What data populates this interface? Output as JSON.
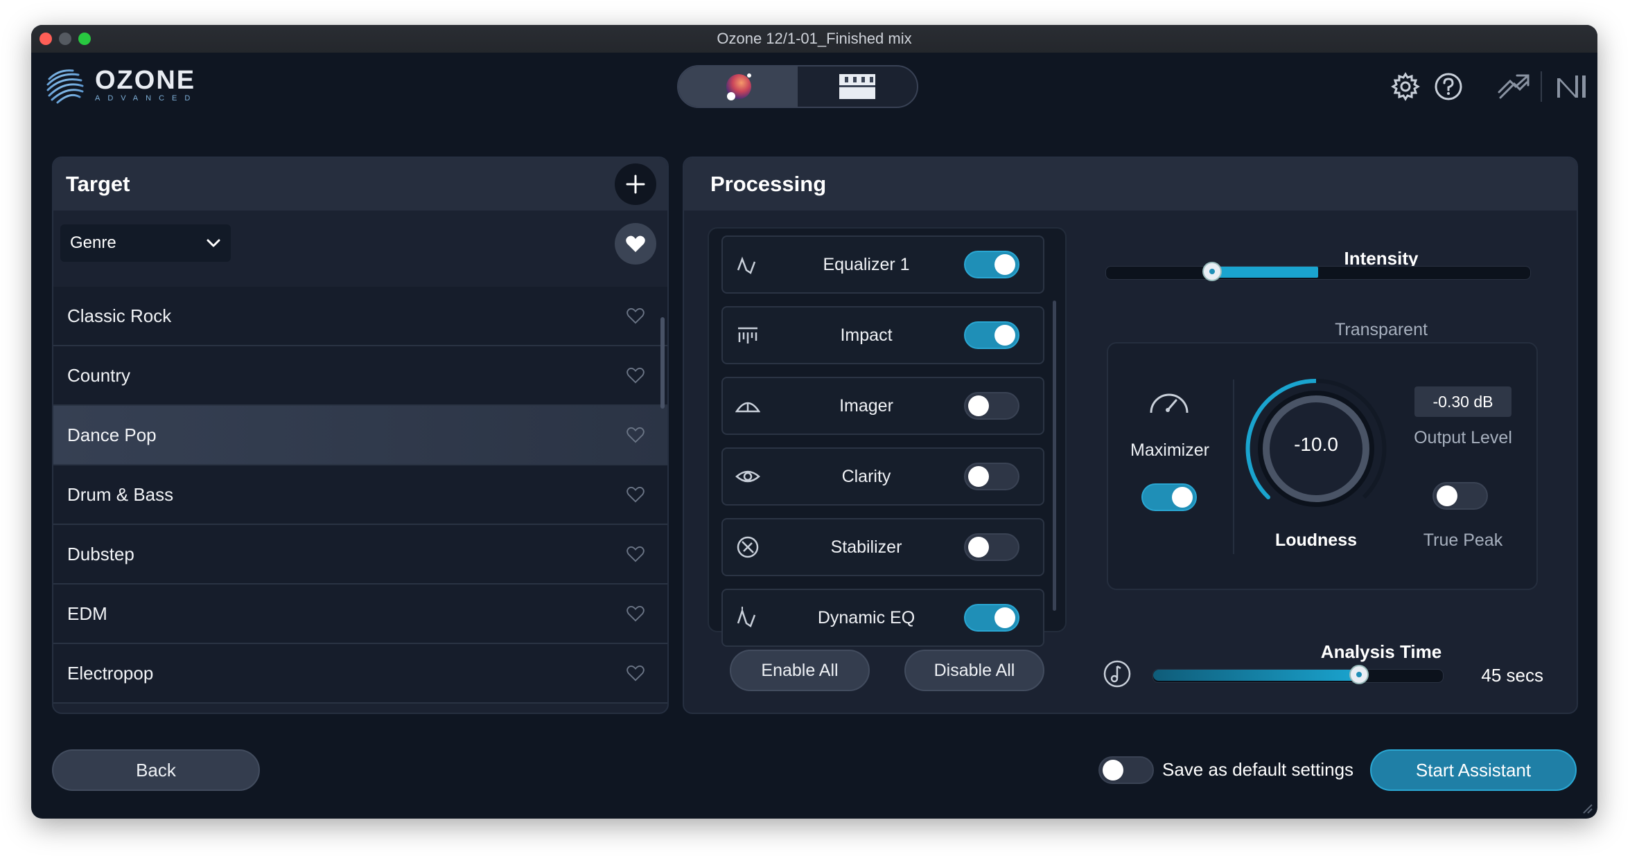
{
  "window": {
    "title": "Ozone 12/1-01_Finished mix"
  },
  "logo": {
    "name": "OZONE",
    "edition": "ADVANCED"
  },
  "header": {
    "modes": [
      {
        "icon": "assistant-orb-icon",
        "active": true
      },
      {
        "icon": "modules-grid-icon",
        "active": false
      }
    ],
    "icons": [
      "gear-icon",
      "help-icon",
      "plugin-link-icon",
      "ni-logo-icon"
    ]
  },
  "target": {
    "title": "Target",
    "dropdown": "Genre",
    "genres": [
      {
        "label": "Classic Rock",
        "selected": false
      },
      {
        "label": "Country",
        "selected": false
      },
      {
        "label": "Dance Pop",
        "selected": true
      },
      {
        "label": "Drum & Bass",
        "selected": false
      },
      {
        "label": "Dubstep",
        "selected": false
      },
      {
        "label": "EDM",
        "selected": false
      },
      {
        "label": "Electropop",
        "selected": false
      }
    ]
  },
  "processing": {
    "title": "Processing",
    "modules": [
      {
        "label": "Equalizer 1",
        "icon": "eq-curve-icon",
        "enabled": true
      },
      {
        "label": "Impact",
        "icon": "impact-icon",
        "enabled": true
      },
      {
        "label": "Imager",
        "icon": "imager-icon",
        "enabled": false
      },
      {
        "label": "Clarity",
        "icon": "eye-icon",
        "enabled": false
      },
      {
        "label": "Stabilizer",
        "icon": "stabilizer-icon",
        "enabled": false
      },
      {
        "label": "Dynamic EQ",
        "icon": "dynamic-eq-icon",
        "enabled": true
      }
    ],
    "enable_all": "Enable All",
    "disable_all": "Disable All",
    "intensity": {
      "label": "Intensity",
      "value_label": "Transparent",
      "level": 0.25,
      "fill_end": 0.5
    },
    "maximizer": {
      "label": "Maximizer",
      "enabled": true,
      "loudness_value": "-10.0",
      "loudness_label": "Loudness",
      "output_level": "-0.30 dB",
      "output_level_label": "Output Level",
      "true_peak_label": "True Peak",
      "true_peak_enabled": false
    },
    "analysis_time": {
      "label": "Analysis Time",
      "value": "45 secs",
      "level": 0.71
    }
  },
  "footer": {
    "back": "Back",
    "save_default": "Save as default settings",
    "save_default_enabled": false,
    "start": "Start Assistant"
  },
  "colors": {
    "accent": "#1f8fb7",
    "background": "#0f1622",
    "panel": "#1b2231"
  }
}
